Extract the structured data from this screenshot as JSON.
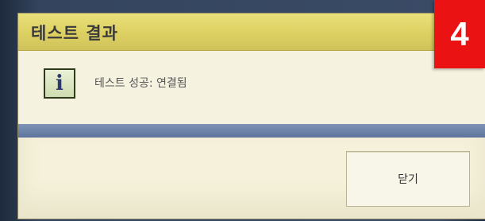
{
  "dialog": {
    "title": "테스트 결과",
    "icon": "info-icon",
    "icon_glyph": "i",
    "message": "테스트 성공: 연결됨",
    "close_label": "닫기"
  },
  "step_badge": {
    "label": "4",
    "color": "#ea1212"
  },
  "colors": {
    "titlebar": "#ddd062",
    "separator": "#6b80a8",
    "background": "#f5f2df"
  }
}
